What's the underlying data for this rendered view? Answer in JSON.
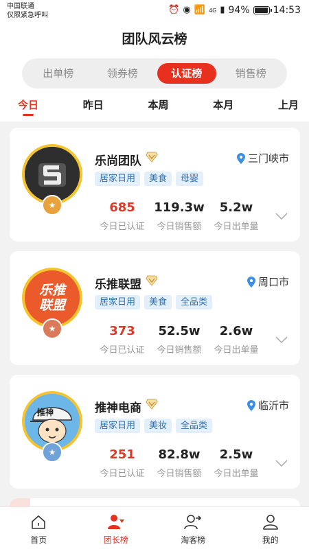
{
  "status": {
    "carrier_line1": "中国联通",
    "carrier_line2": "仅限紧急呼叫",
    "network": "4G",
    "battery": "94%",
    "time": "14:53"
  },
  "header": {
    "title": "团队风云榜",
    "segments": [
      "出单榜",
      "领券榜",
      "认证榜",
      "销售榜"
    ],
    "active_segment": "认证榜",
    "periods": [
      "今日",
      "昨日",
      "本周",
      "本月",
      "上月"
    ],
    "active_period": "今日"
  },
  "teams": [
    {
      "name": "乐尚团队",
      "location": "三门峡市",
      "tags": [
        "居家日用",
        "美食",
        "母婴"
      ],
      "stats": [
        {
          "value": "685",
          "label": "今日已认证"
        },
        {
          "value": "119.3w",
          "label": "今日销售额"
        },
        {
          "value": "5.2w",
          "label": "今日出单量"
        }
      ],
      "rank_color": "#e9a23b"
    },
    {
      "name": "乐推联盟",
      "location": "周口市",
      "tags": [
        "居家日用",
        "美食",
        "全品类"
      ],
      "stats": [
        {
          "value": "373",
          "label": "今日已认证"
        },
        {
          "value": "52.5w",
          "label": "今日销售额"
        },
        {
          "value": "2.6w",
          "label": "今日出单量"
        }
      ],
      "avatar_text": [
        "乐推",
        "联盟"
      ],
      "rank_color": "#d97b5a"
    },
    {
      "name": "推神电商",
      "location": "临沂市",
      "tags": [
        "居家日用",
        "美妆",
        "全品类"
      ],
      "stats": [
        {
          "value": "251",
          "label": "今日已认证"
        },
        {
          "value": "82.8w",
          "label": "今日销售额"
        },
        {
          "value": "2.5w",
          "label": "今日出单量"
        }
      ],
      "avatar_text": [
        "推神"
      ],
      "rank_color": "#6fa3d9"
    }
  ],
  "tabbar": {
    "items": [
      "首页",
      "团长榜",
      "淘客榜",
      "我的"
    ],
    "active": "团长榜"
  },
  "colors": {
    "accent": "#e8301f",
    "tag_bg": "#e3f0fb",
    "tag_text": "#2e6fb0",
    "avatar_ring": "#f4c32e"
  }
}
